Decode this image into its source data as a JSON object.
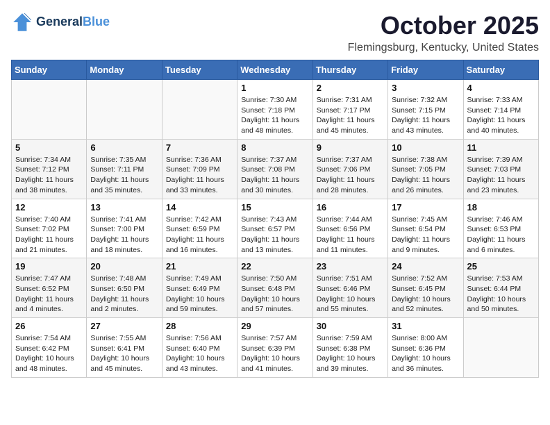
{
  "header": {
    "logo_line1": "General",
    "logo_line2": "Blue",
    "title": "October 2025",
    "subtitle": "Flemingsburg, Kentucky, United States"
  },
  "days_of_week": [
    "Sunday",
    "Monday",
    "Tuesday",
    "Wednesday",
    "Thursday",
    "Friday",
    "Saturday"
  ],
  "weeks": [
    [
      {
        "day": "",
        "info": ""
      },
      {
        "day": "",
        "info": ""
      },
      {
        "day": "",
        "info": ""
      },
      {
        "day": "1",
        "info": "Sunrise: 7:30 AM\nSunset: 7:18 PM\nDaylight: 11 hours and 48 minutes."
      },
      {
        "day": "2",
        "info": "Sunrise: 7:31 AM\nSunset: 7:17 PM\nDaylight: 11 hours and 45 minutes."
      },
      {
        "day": "3",
        "info": "Sunrise: 7:32 AM\nSunset: 7:15 PM\nDaylight: 11 hours and 43 minutes."
      },
      {
        "day": "4",
        "info": "Sunrise: 7:33 AM\nSunset: 7:14 PM\nDaylight: 11 hours and 40 minutes."
      }
    ],
    [
      {
        "day": "5",
        "info": "Sunrise: 7:34 AM\nSunset: 7:12 PM\nDaylight: 11 hours and 38 minutes."
      },
      {
        "day": "6",
        "info": "Sunrise: 7:35 AM\nSunset: 7:11 PM\nDaylight: 11 hours and 35 minutes."
      },
      {
        "day": "7",
        "info": "Sunrise: 7:36 AM\nSunset: 7:09 PM\nDaylight: 11 hours and 33 minutes."
      },
      {
        "day": "8",
        "info": "Sunrise: 7:37 AM\nSunset: 7:08 PM\nDaylight: 11 hours and 30 minutes."
      },
      {
        "day": "9",
        "info": "Sunrise: 7:37 AM\nSunset: 7:06 PM\nDaylight: 11 hours and 28 minutes."
      },
      {
        "day": "10",
        "info": "Sunrise: 7:38 AM\nSunset: 7:05 PM\nDaylight: 11 hours and 26 minutes."
      },
      {
        "day": "11",
        "info": "Sunrise: 7:39 AM\nSunset: 7:03 PM\nDaylight: 11 hours and 23 minutes."
      }
    ],
    [
      {
        "day": "12",
        "info": "Sunrise: 7:40 AM\nSunset: 7:02 PM\nDaylight: 11 hours and 21 minutes."
      },
      {
        "day": "13",
        "info": "Sunrise: 7:41 AM\nSunset: 7:00 PM\nDaylight: 11 hours and 18 minutes."
      },
      {
        "day": "14",
        "info": "Sunrise: 7:42 AM\nSunset: 6:59 PM\nDaylight: 11 hours and 16 minutes."
      },
      {
        "day": "15",
        "info": "Sunrise: 7:43 AM\nSunset: 6:57 PM\nDaylight: 11 hours and 13 minutes."
      },
      {
        "day": "16",
        "info": "Sunrise: 7:44 AM\nSunset: 6:56 PM\nDaylight: 11 hours and 11 minutes."
      },
      {
        "day": "17",
        "info": "Sunrise: 7:45 AM\nSunset: 6:54 PM\nDaylight: 11 hours and 9 minutes."
      },
      {
        "day": "18",
        "info": "Sunrise: 7:46 AM\nSunset: 6:53 PM\nDaylight: 11 hours and 6 minutes."
      }
    ],
    [
      {
        "day": "19",
        "info": "Sunrise: 7:47 AM\nSunset: 6:52 PM\nDaylight: 11 hours and 4 minutes."
      },
      {
        "day": "20",
        "info": "Sunrise: 7:48 AM\nSunset: 6:50 PM\nDaylight: 11 hours and 2 minutes."
      },
      {
        "day": "21",
        "info": "Sunrise: 7:49 AM\nSunset: 6:49 PM\nDaylight: 10 hours and 59 minutes."
      },
      {
        "day": "22",
        "info": "Sunrise: 7:50 AM\nSunset: 6:48 PM\nDaylight: 10 hours and 57 minutes."
      },
      {
        "day": "23",
        "info": "Sunrise: 7:51 AM\nSunset: 6:46 PM\nDaylight: 10 hours and 55 minutes."
      },
      {
        "day": "24",
        "info": "Sunrise: 7:52 AM\nSunset: 6:45 PM\nDaylight: 10 hours and 52 minutes."
      },
      {
        "day": "25",
        "info": "Sunrise: 7:53 AM\nSunset: 6:44 PM\nDaylight: 10 hours and 50 minutes."
      }
    ],
    [
      {
        "day": "26",
        "info": "Sunrise: 7:54 AM\nSunset: 6:42 PM\nDaylight: 10 hours and 48 minutes."
      },
      {
        "day": "27",
        "info": "Sunrise: 7:55 AM\nSunset: 6:41 PM\nDaylight: 10 hours and 45 minutes."
      },
      {
        "day": "28",
        "info": "Sunrise: 7:56 AM\nSunset: 6:40 PM\nDaylight: 10 hours and 43 minutes."
      },
      {
        "day": "29",
        "info": "Sunrise: 7:57 AM\nSunset: 6:39 PM\nDaylight: 10 hours and 41 minutes."
      },
      {
        "day": "30",
        "info": "Sunrise: 7:59 AM\nSunset: 6:38 PM\nDaylight: 10 hours and 39 minutes."
      },
      {
        "day": "31",
        "info": "Sunrise: 8:00 AM\nSunset: 6:36 PM\nDaylight: 10 hours and 36 minutes."
      },
      {
        "day": "",
        "info": ""
      }
    ]
  ]
}
